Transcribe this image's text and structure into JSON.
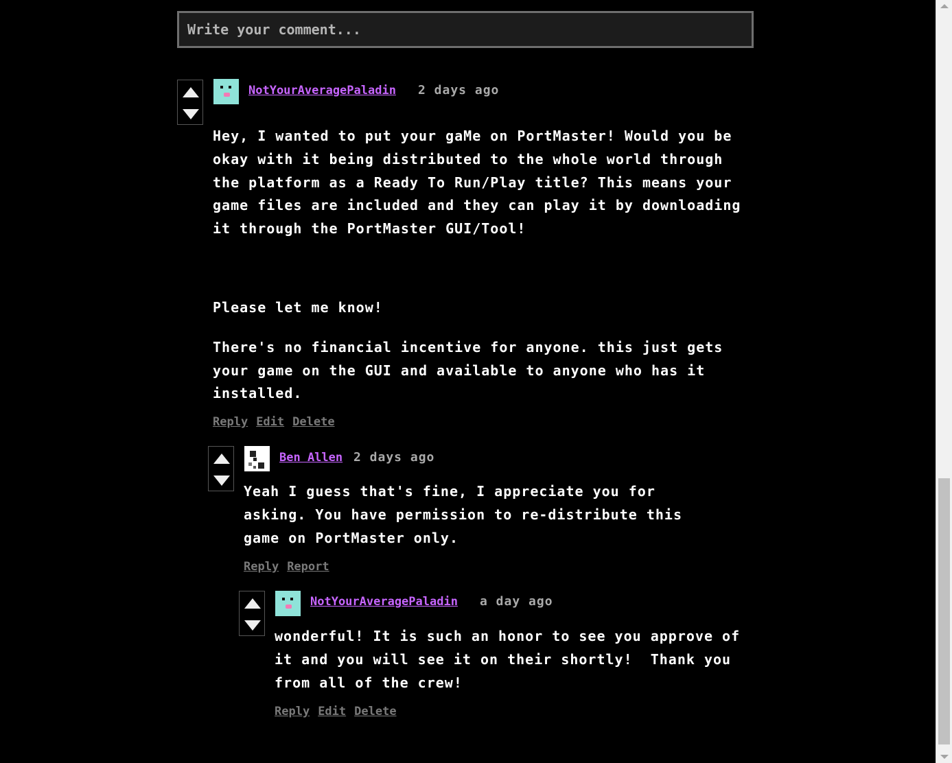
{
  "comment_input": {
    "placeholder": "Write your comment..."
  },
  "comments": [
    {
      "author": "NotYourAveragePaladin",
      "time": "2 days ago",
      "paragraphs": [
        "Hey, I wanted to put your gaMe on PortMaster! Would you be okay with it being distributed to the whole world through the platform as a Ready To Run/Play title? This means your game files are included and they can play it by downloading it through the PortMaster GUI/Tool!",
        "Please let me know!",
        "There's no financial incentive for anyone. this just gets your game on the GUI and available to anyone who has it installed."
      ],
      "actions": [
        "Reply",
        "Edit",
        "Delete"
      ]
    },
    {
      "author": "Ben Allen",
      "time": "2 days ago",
      "paragraphs": [
        "Yeah I guess that's fine, I appreciate you for asking. You have permission to re-distribute this game on PortMaster only."
      ],
      "actions": [
        "Reply",
        "Report"
      ]
    },
    {
      "author": "NotYourAveragePaladin",
      "time": "a day ago",
      "paragraphs": [
        "wonderful! It is such an honor to see you approve of it and you will see it on their shortly!  Thank you from all of the crew!"
      ],
      "actions": [
        "Reply",
        "Edit",
        "Delete"
      ]
    }
  ],
  "colors": {
    "author": "#c765ff",
    "background": "#000000",
    "action_link": "#7a7a7a",
    "avatar_mint": "#8fe3d9"
  }
}
